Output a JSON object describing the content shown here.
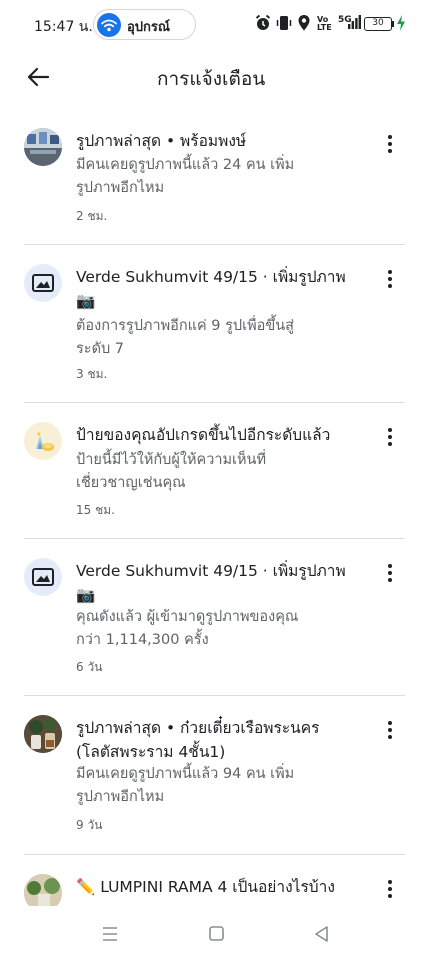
{
  "status_bar": {
    "time": "15:47 น.",
    "device_chip_label": "อุปกรณ์",
    "network_label": "5G",
    "volte_top": "Vo",
    "volte_bottom": "LTE",
    "battery_level": "30",
    "icons": [
      "alarm-icon",
      "vibrate-icon",
      "location-icon",
      "volte-icon",
      "signal-icon",
      "battery-icon",
      "charging-icon"
    ]
  },
  "header": {
    "title": "การแจ้งเตือน",
    "back_icon": "arrow-back-icon"
  },
  "notifications": [
    {
      "title": "รูปภาพล่าสุด • พร้อมพงษ์",
      "body": [
        "มีคนเคยดูรูปภาพนี้แล้ว 24 คน เพิ่ม",
        "รูปภาพอีกไหม"
      ],
      "time": "2 ชม.",
      "avatar": "photo-thumbnail"
    },
    {
      "title": "Verde Sukhumvit 49/15 · เพิ่มรูปภาพ",
      "title_extra": "📷",
      "body": [
        "ต้องการรูปภาพอีกแค่ 9 รูปเพื่อขึ้นสู่",
        "ระดับ 7"
      ],
      "time": "3 ชม.",
      "avatar": "photo-add-icon"
    },
    {
      "title": "ป้ายของคุณอัปเกรดขึ้นไปอีกระดับแล้ว",
      "body": [
        "ป้ายนี้มีไว้ให้กับผู้ให้ความเห็นที่",
        "เชี่ยวชาญเช่นคุณ"
      ],
      "time": "15 ชม.",
      "avatar": "badge-icon"
    },
    {
      "title": "Verde Sukhumvit 49/15 · เพิ่มรูปภาพ",
      "title_extra": "📷",
      "body": [
        "คุณดังแล้ว ผู้เข้ามาดูรูปภาพของคุณ",
        "กว่า 1,114,300 ครั้ง"
      ],
      "time": "6 วัน",
      "avatar": "photo-add-icon"
    },
    {
      "title": "รูปภาพล่าสุด • ก๋วยเตี๋ยวเรือพระนคร",
      "title_extra": "(โลตัสพระราม 4ชั้น1)",
      "body": [
        "มีคนเคยดูรูปภาพนี้แล้ว 94 คน เพิ่ม",
        "รูปภาพอีกไหม"
      ],
      "time": "9 วัน",
      "avatar": "photo-thumbnail"
    },
    {
      "title": "✏️ LUMPINI RAMA 4 เป็นอย่างไรบ้าง",
      "avatar": "photo-thumbnail"
    }
  ],
  "nav_bar": {
    "icons": [
      "recents-icon",
      "home-icon",
      "back-icon"
    ]
  },
  "colors": {
    "primary_text": "#202124",
    "secondary_text": "#5f6368",
    "divider": "#dadce0",
    "accent": "#1a73e8"
  }
}
